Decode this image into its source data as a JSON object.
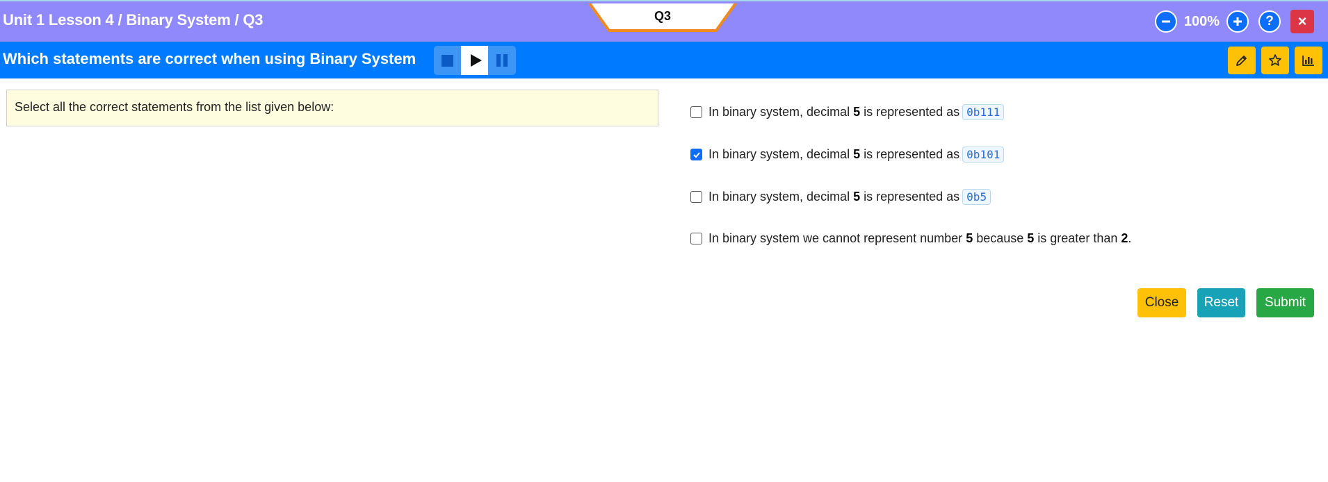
{
  "header": {
    "breadcrumb": "Unit 1 Lesson 4 / Binary System / Q3",
    "question_tab": "Q3",
    "zoom": "100%",
    "zoom_out_symbol": "−",
    "zoom_in_symbol": "+",
    "help_symbol": "?",
    "close_symbol": "×"
  },
  "subheader": {
    "title": "Which statements are correct when using Binary System",
    "media_controls": [
      "stop-icon",
      "play-icon",
      "pause-icon"
    ],
    "tools": [
      "pencil-icon",
      "star-icon",
      "bar-chart-icon"
    ]
  },
  "instruction": "Select all the correct statements from the list given below:",
  "options": [
    {
      "checked": false,
      "prefix": "In binary system, decimal",
      "number": "5",
      "middle": "is represented as",
      "code": "0b111"
    },
    {
      "checked": true,
      "prefix": "In binary system, decimal",
      "number": "5",
      "middle": "is represented as",
      "code": "0b101"
    },
    {
      "checked": false,
      "prefix": "In binary system, decimal",
      "number": "5",
      "middle": "is represented as",
      "code": "0b5"
    }
  ],
  "option4": {
    "checked": false,
    "part1": "In binary system we cannot represent number",
    "num1": "5",
    "part2": "because",
    "num2": "5",
    "part3": "is greater than",
    "num3": "2",
    "end": "."
  },
  "actions": {
    "close": "Close",
    "reset": "Reset",
    "submit": "Submit"
  },
  "colors": {
    "header_bg": "#9089fc",
    "subheader_bg": "#007bff",
    "tab_border": "#f08a1c",
    "instruction_bg": "#fefde0",
    "tool_btn": "#ffc107",
    "close_x_btn": "#dc3545",
    "reset_btn": "#17a2b8",
    "submit_btn": "#28a745"
  }
}
